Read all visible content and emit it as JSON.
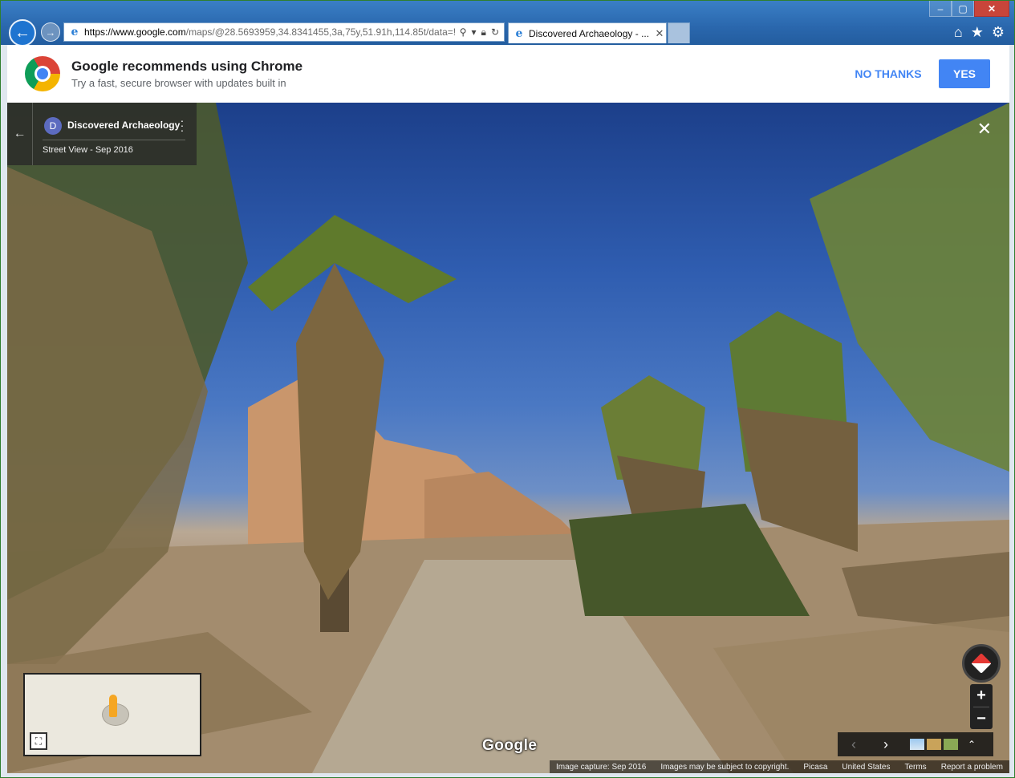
{
  "browser": {
    "url_host": "https://www.google.com",
    "url_rest": "/maps/@28.5693959,34.8341455,3a,75y,51.91h,114.85t/data=!",
    "tab_title": "Discovered Archaeology - ...",
    "back_icon": "back-arrow-icon",
    "forward_icon": "forward-arrow-icon"
  },
  "banner": {
    "title": "Google recommends using Chrome",
    "subtitle": "Try a fast, secure browser with updates built in",
    "no_thanks": "NO THANKS",
    "yes": "YES",
    "accent": "#4285f4"
  },
  "streetview": {
    "avatar_letter": "D",
    "place_name": "Discovered Archaeology",
    "subtitle": "Street View - Sep 2016",
    "google_logo": "Google",
    "zoom_in": "+",
    "zoom_out": "−",
    "footer": {
      "capture": "Image capture: Sep 2016",
      "copyright": "Images may be subject to copyright.",
      "picasa": "Picasa",
      "country": "United States",
      "terms": "Terms",
      "report": "Report a problem"
    }
  }
}
